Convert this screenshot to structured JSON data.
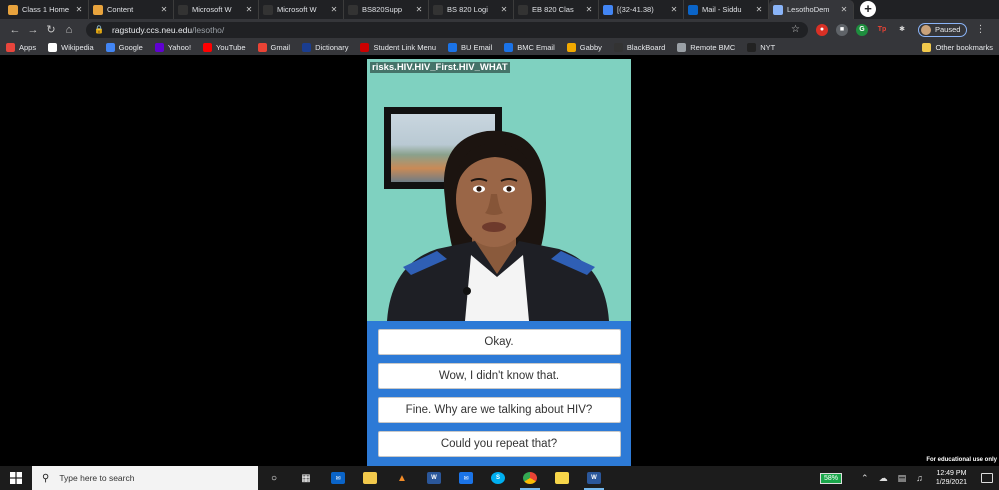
{
  "browser": {
    "tabs": [
      {
        "title": "Class 1 Home",
        "icon": "orange-square-icon",
        "color": "#e8a33d",
        "active": false
      },
      {
        "title": "Content",
        "icon": "orange-square-icon",
        "color": "#e8a33d",
        "active": false
      },
      {
        "title": "Microsoft W",
        "icon": "bb-icon",
        "color": "#333333",
        "active": false
      },
      {
        "title": "Microsoft W",
        "icon": "bb-icon",
        "color": "#333333",
        "active": false
      },
      {
        "title": "BS820Supp",
        "icon": "bb-icon",
        "color": "#333333",
        "active": false
      },
      {
        "title": "BS 820 Logi",
        "icon": "bb-icon",
        "color": "#333333",
        "active": false
      },
      {
        "title": "EB 820 Clas",
        "icon": "bb-icon",
        "color": "#333333",
        "active": false
      },
      {
        "title": "[(32-41.38)",
        "icon": "google-icon",
        "color": "#4285f4",
        "active": false
      },
      {
        "title": "Mail - Siddu",
        "icon": "outlook-icon",
        "color": "#0a64c8",
        "active": false
      },
      {
        "title": "LesothoDem",
        "icon": "globe-icon",
        "color": "#8ab4f8",
        "active": true
      }
    ],
    "address": {
      "host": "ragstudy.ccs.neu.edu",
      "path": "/lesotho/"
    },
    "profile_label": "Paused",
    "bookmarks": [
      {
        "label": "Apps",
        "icon": "apps-grid-icon",
        "color": "#e8453c"
      },
      {
        "label": "Wikipedia",
        "icon": "wikipedia-icon",
        "color": "#ffffff"
      },
      {
        "label": "Google",
        "icon": "google-icon",
        "color": "#4285f4"
      },
      {
        "label": "Yahoo!",
        "icon": "yahoo-icon",
        "color": "#6001d2"
      },
      {
        "label": "YouTube",
        "icon": "youtube-icon",
        "color": "#ff0000"
      },
      {
        "label": "Gmail",
        "icon": "gmail-icon",
        "color": "#ea4335"
      },
      {
        "label": "Dictionary",
        "icon": "dictionary-icon",
        "color": "#1a3d8f"
      },
      {
        "label": "Student Link Menu",
        "icon": "bu-icon",
        "color": "#cc0000"
      },
      {
        "label": "BU Email",
        "icon": "bu-email-icon",
        "color": "#1a73e8"
      },
      {
        "label": "BMC Email",
        "icon": "bmc-email-icon",
        "color": "#1a73e8"
      },
      {
        "label": "Gabby",
        "icon": "gabby-icon",
        "color": "#f2a900"
      },
      {
        "label": "BlackBoard",
        "icon": "bb-icon",
        "color": "#333333"
      },
      {
        "label": "Remote BMC",
        "icon": "remote-icon",
        "color": "#9aa0a6"
      },
      {
        "label": "NYT",
        "icon": "nyt-icon",
        "color": "#222222"
      }
    ],
    "other_bookmarks": "Other bookmarks"
  },
  "app": {
    "debug_label": "risks.HIV.HIV_First.HIV_WHAT",
    "choices": [
      "Okay.",
      "Wow, I didn't know that.",
      "Fine. Why are we talking about HIV?",
      "Could you repeat that?"
    ],
    "colors": {
      "scene_bg": "#7fd1c0",
      "choices_bg": "#2d7ad6"
    }
  },
  "watermark": "For educational use only",
  "taskbar": {
    "search_placeholder": "Type here to search",
    "battery": "58%",
    "time": "12:49 PM",
    "date": "1/29/2021"
  }
}
